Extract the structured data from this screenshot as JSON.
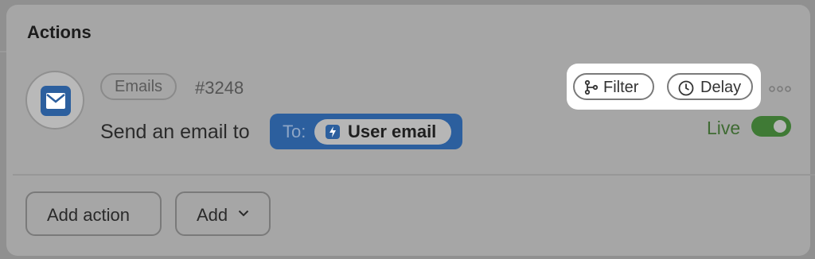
{
  "panel": {
    "title": "Actions"
  },
  "action": {
    "icon": "envelope-icon",
    "tag": "Emails",
    "record_id": "#3248",
    "sentence": "Send an email to",
    "recipient": {
      "prefix": "To:",
      "icon": "bolt-icon",
      "value": "User email"
    },
    "controls": {
      "filter_label": "Filter",
      "filter_icon": "branch-icon",
      "delay_label": "Delay",
      "delay_icon": "clock-icon",
      "more_icon": "more-horizontal-icon"
    },
    "status": {
      "label": "Live",
      "enabled": true
    }
  },
  "footer": {
    "add_action_label": "Add action",
    "add_label": "Add",
    "add_icon": "chevron-down-icon"
  },
  "colors": {
    "accent_blue": "#2c5f9e",
    "live_green": "#3f7a35"
  }
}
